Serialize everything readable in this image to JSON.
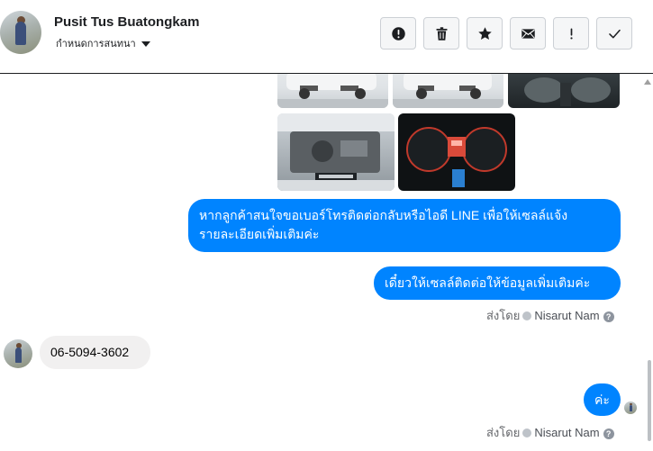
{
  "header": {
    "contact_name": "Pusit Tus Buatongkam",
    "conversation_label": "กำหนดการสนทนา",
    "toolbar": [
      {
        "name": "report-button",
        "icon": "alert-circle-icon"
      },
      {
        "name": "delete-button",
        "icon": "trash-icon"
      },
      {
        "name": "star-button",
        "icon": "star-icon"
      },
      {
        "name": "mark-unread-button",
        "icon": "envelope-icon"
      },
      {
        "name": "spam-button",
        "icon": "exclamation-icon"
      },
      {
        "name": "mark-done-button",
        "icon": "check-icon"
      }
    ]
  },
  "images": [
    {
      "name": "car-photo-front",
      "icon": "car-photo"
    },
    {
      "name": "car-photo-front-2",
      "icon": "car-photo"
    },
    {
      "name": "car-photo-interior",
      "icon": "car-photo"
    },
    {
      "name": "car-photo-engine",
      "icon": "car-photo"
    },
    {
      "name": "car-photo-dashboard",
      "icon": "car-photo"
    }
  ],
  "messages": {
    "out_1_line1": "หากลูกค้าสนใจขอเบอร์โทรติดต่อกลับหรือไอดี LINE เพื่อให้เซลล์แจ้ง",
    "out_1_line2": "รายละเอียดเพิ่มเติมค่ะ",
    "out_2": "เดี๋ยวให้เซลล์ติดต่อให้ข้อมูลเพิ่มเติมค่ะ",
    "sent_by_1_prefix": "ส่งโดย",
    "sent_by_1_name": "Nisarut Nam",
    "in_1": "06-5094-3602",
    "out_3": "ค่ะ",
    "sent_by_2_prefix": "ส่งโดย",
    "sent_by_2_name": "Nisarut Nam"
  },
  "colors": {
    "outgoing_bubble": "#0084ff",
    "incoming_bubble": "#f1f0f0"
  }
}
